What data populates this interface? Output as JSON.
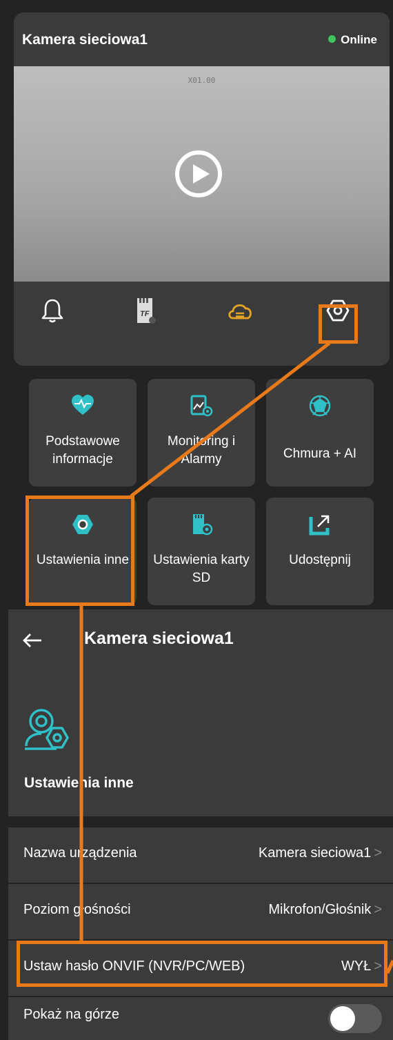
{
  "camera": {
    "title": "Kamera sieciowa1",
    "status": "Online",
    "timestamp": "X01.00"
  },
  "toolbar": {
    "icons": [
      "bell-icon",
      "sd-card-icon",
      "cloud-icon",
      "settings-hex-icon"
    ]
  },
  "tiles": [
    {
      "label": "Podstawowe informacje",
      "icon": "heart-pulse-icon"
    },
    {
      "label": "Monitoring i Alarmy",
      "icon": "monitoring-icon"
    },
    {
      "label": "Chmura + AI",
      "icon": "ai-sphere-icon"
    },
    {
      "label": "Ustawienia inne",
      "icon": "settings-hex-icon"
    },
    {
      "label": "Ustawienia karty SD",
      "icon": "sd-settings-icon"
    },
    {
      "label": "Udostępnij",
      "icon": "share-icon"
    }
  ],
  "settings": {
    "header_title": "Kamera sieciowa1",
    "section_title": "Ustawienia inne",
    "rows": [
      {
        "label": "Nazwa urządzenia",
        "value": "Kamera sieciowa1"
      },
      {
        "label": "Poziom głośności",
        "value": "Mikrofon/Głośnik"
      },
      {
        "label": "Ustaw hasło ONVIF (NVR/PC/WEB)",
        "value": "WYŁ"
      },
      {
        "label": "Pokaż na górze",
        "value": ""
      }
    ],
    "chevron": ">"
  },
  "colors": {
    "accent": "#e87a1a",
    "teal": "#2fc0c8",
    "yellow": "#e6a623",
    "online": "#3fc55c"
  }
}
